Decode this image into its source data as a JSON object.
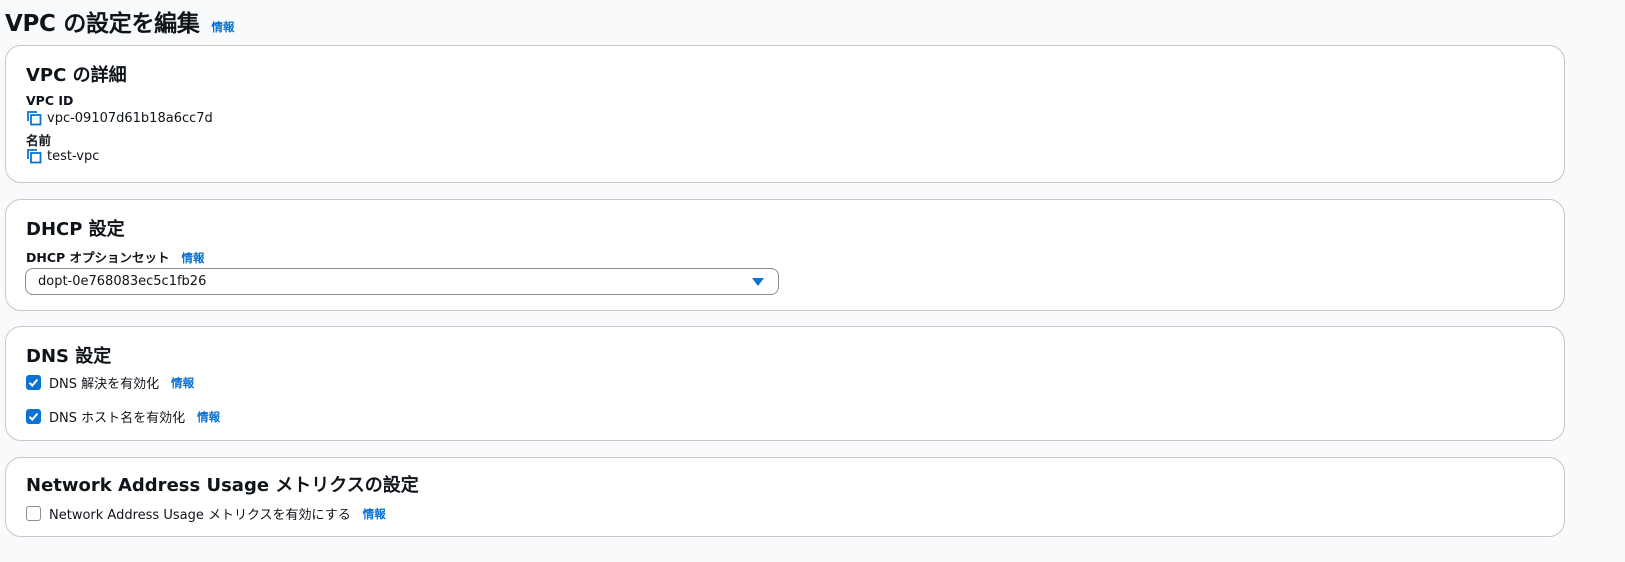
{
  "header": {
    "title": "VPC の設定を編集",
    "info": "情報"
  },
  "vpc_details": {
    "title": "VPC の詳細",
    "vpc_id_label": "VPC ID",
    "vpc_id_value": "vpc-09107d61b18a6cc7d",
    "name_label": "名前",
    "name_value": "test-vpc"
  },
  "dhcp": {
    "title": "DHCP 設定",
    "option_set_label": "DHCP オプションセット",
    "info": "情報",
    "selected_value": "dopt-0e768083ec5c1fb26"
  },
  "dns": {
    "title": "DNS 設定",
    "resolution_label": "DNS 解決を有効化",
    "resolution_checked": true,
    "hostnames_label": "DNS ホスト名を有効化",
    "hostnames_checked": true,
    "info": "情報"
  },
  "nau": {
    "title": "Network Address Usage メトリクスの設定",
    "enable_label": "Network Address Usage メトリクスを有効にする",
    "enable_checked": false,
    "info": "情報"
  },
  "colors": {
    "accent": "#0972d3",
    "border": "#c6c6cd",
    "text": "#0f141a"
  }
}
